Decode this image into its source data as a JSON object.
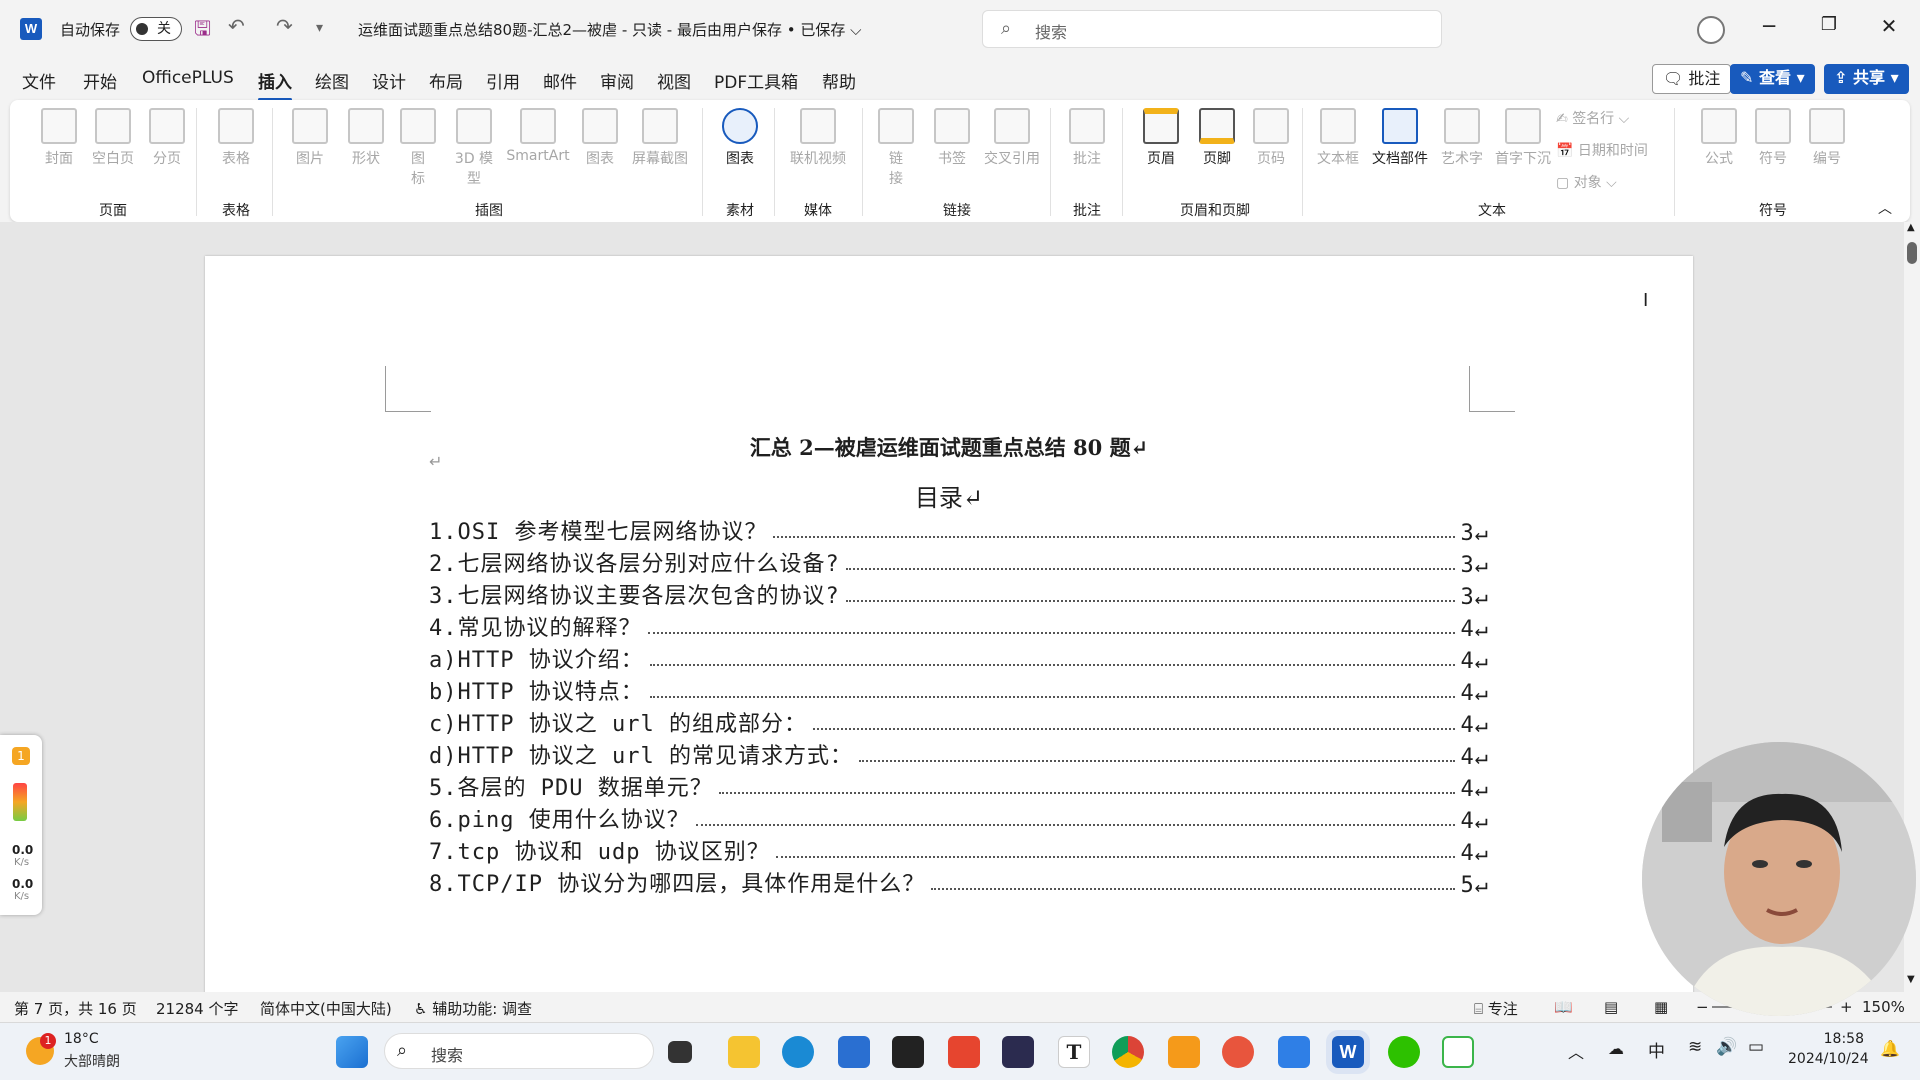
{
  "titlebar": {
    "app_logo": "W",
    "autosave_label": "自动保存",
    "autosave_state": "关",
    "doc_title": "运维面试题重点总结80题-汇总2—被虐  -  只读  -  最后由用户保存 • 已保存 ⌵",
    "search_placeholder": "搜索",
    "icons": [
      "word-logo",
      "save-icon",
      "undo-icon",
      "redo-icon",
      "customize-icon",
      "search-icon",
      "account-icon",
      "minimize-icon",
      "restore-icon",
      "close-icon"
    ]
  },
  "menu": {
    "items": [
      "文件",
      "开始",
      "OfficePLUS",
      "插入",
      "绘图",
      "设计",
      "布局",
      "引用",
      "邮件",
      "审阅",
      "视图",
      "PDF工具箱",
      "帮助"
    ],
    "active": "插入",
    "comment_btn": "批注",
    "view_btn": "查看",
    "share_btn": "共享"
  },
  "ribbon": {
    "buttons": {
      "cover": "封面",
      "blank": "空白页",
      "pagebreak": "分页",
      "table": "表格",
      "picture": "图片",
      "shapes": "形状",
      "icons": "图\n标",
      "model3d": "3D 模\n型",
      "smartart": "SmartArt",
      "chart": "图表",
      "screenshot": "屏幕截图",
      "chartmaterial": "图表",
      "onlinevideo": "联机视频",
      "link": "链\n接",
      "bookmark": "书签",
      "crossref": "交叉引用",
      "comment": "批注",
      "header": "页眉",
      "footer": "页脚",
      "pagenum": "页码",
      "textbox": "文本框",
      "quickparts": "文档部件",
      "wordart": "艺术字",
      "dropcap": "首字下沉",
      "signline": "签名行",
      "datetime": "日期和时间",
      "object": "对象",
      "equation": "公式",
      "symbol": "符号",
      "number": "编号"
    },
    "groups": {
      "pages": "页面",
      "tables": "表格",
      "illustrations": "插图",
      "material": "素材",
      "media": "媒体",
      "links": "链接",
      "comments": "批注",
      "headerfooter": "页眉和页脚",
      "text": "文本",
      "symbols": "符号"
    }
  },
  "document": {
    "heading": "汇总 2—被虐运维面试题重点总结 80 题↵",
    "blank_line": "↵",
    "toc_title": "目录↵",
    "toc": [
      {
        "text": "1.OSI 参考模型七层网络协议？",
        "page": "3↵"
      },
      {
        "text": "2.七层网络协议各层分别对应什么设备?",
        "page": "3↵"
      },
      {
        "text": "3.七层网络协议主要各层次包含的协议?",
        "page": "3↵"
      },
      {
        "text": "4.常见协议的解释？",
        "page": "4↵"
      },
      {
        "text": "a)HTTP 协议介绍：",
        "page": "4↵"
      },
      {
        "text": "b)HTTP 协议特点：",
        "page": "4↵"
      },
      {
        "text": "c)HTTP 协议之 url 的组成部分：",
        "page": "4↵"
      },
      {
        "text": "d)HTTP 协议之 url 的常见请求方式：",
        "page": "4↵"
      },
      {
        "text": "5.各层的 PDU 数据单元？",
        "page": "4↵"
      },
      {
        "text": "6.ping 使用什么协议？",
        "page": "4↵"
      },
      {
        "text": "7.tcp 协议和 udp 协议区别？",
        "page": "4↵"
      },
      {
        "text": "8.TCP/IP 协议分为哪四层，具体作用是什么？",
        "page": "5↵"
      }
    ]
  },
  "statusbar": {
    "page_info": "第 7 页，共 16 页",
    "word_count": "21284 个字",
    "language": "简体中文(中国大陆)",
    "accessibility": "辅助功能: 调查",
    "focus": "专注",
    "zoom": "150%"
  },
  "widget": {
    "badge": "1",
    "net1": "0.0",
    "unit1": "K/s",
    "net2": "0.0",
    "unit2": "K/s"
  },
  "taskbar": {
    "weather_temp": "18°C",
    "weather_desc": "大部晴朗",
    "weather_badge": "1",
    "search_placeholder": "搜索",
    "ime": "中",
    "time": "18:58",
    "date": "2024/10/24"
  },
  "colors": {
    "accent": "#185abd",
    "ribbon_bg": "#ffffff",
    "chrome_bg": "#f3f3f3",
    "workspace_bg": "#e6e6e6"
  }
}
